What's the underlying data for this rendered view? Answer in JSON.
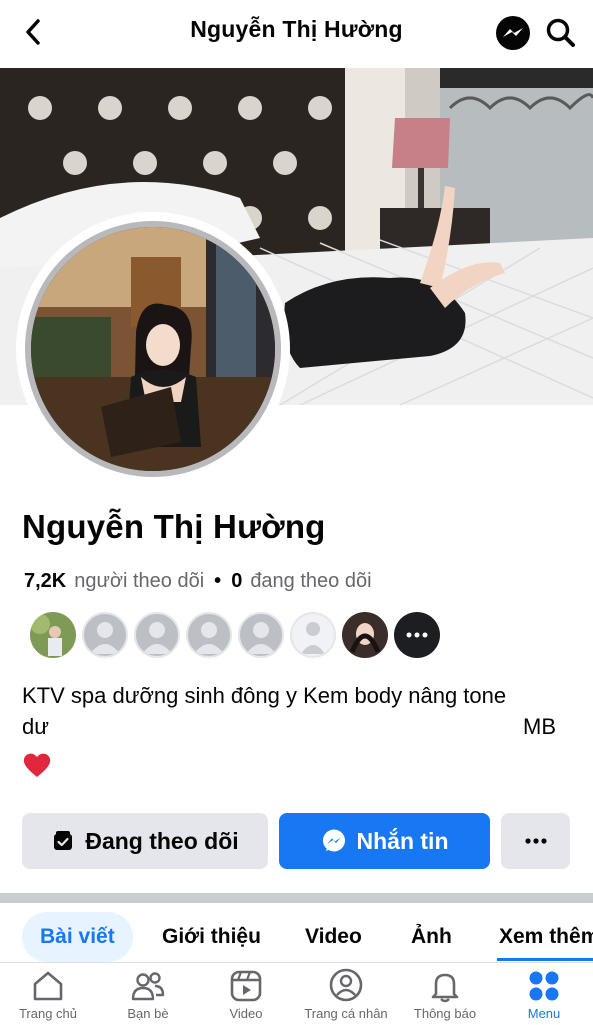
{
  "header": {
    "title": "Nguyễn Thị Hường"
  },
  "profile": {
    "name": "Nguyễn Thị Hường",
    "followers_count": "7,2K",
    "followers_label": "người theo dõi",
    "following_count": "0",
    "following_label": "đang theo dõi",
    "bio_line1": "KTV spa dưỡng sinh đông y Kem body nâng tone",
    "bio_line2_start": "dư",
    "bio_line2_end": "MB"
  },
  "actions": {
    "follow_label": "Đang theo dõi",
    "message_label": "Nhắn tin"
  },
  "tabs": [
    {
      "label": "Bài viết"
    },
    {
      "label": "Giới thiệu"
    },
    {
      "label": "Video"
    },
    {
      "label": "Ảnh"
    },
    {
      "label": "Xem thêm"
    }
  ],
  "bottom_nav": [
    {
      "label": "Trang chủ",
      "icon": "home-icon"
    },
    {
      "label": "Bạn bè",
      "icon": "friends-icon"
    },
    {
      "label": "Video",
      "icon": "video-icon"
    },
    {
      "label": "Trang cá nhân",
      "icon": "profile-icon"
    },
    {
      "label": "Thông báo",
      "icon": "bell-icon"
    },
    {
      "label": "Menu",
      "icon": "menu-icon"
    }
  ],
  "colors": {
    "accent": "#1877f2",
    "button_gray": "#e4e6eb",
    "text_secondary": "#65676b"
  }
}
